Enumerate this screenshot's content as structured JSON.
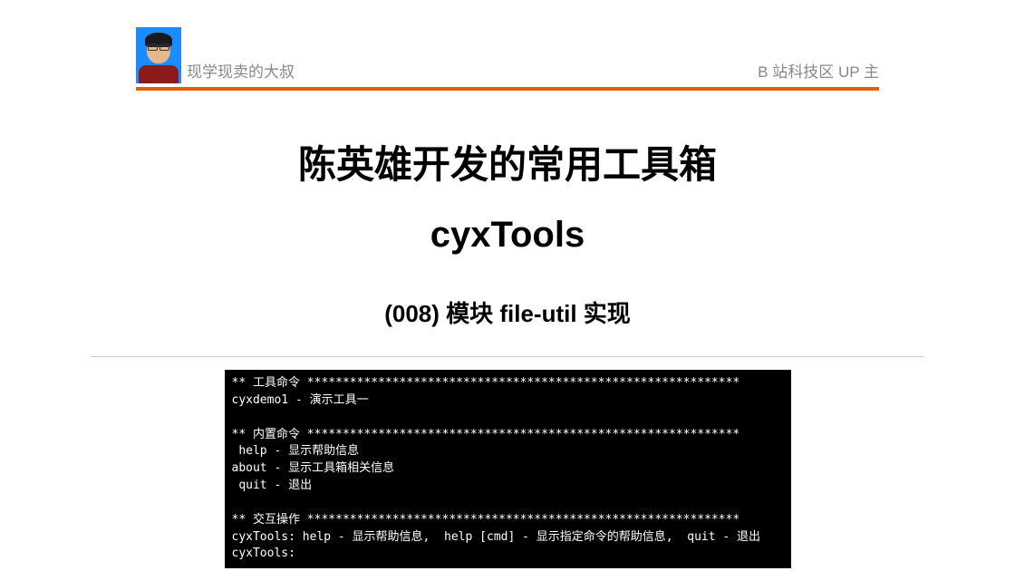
{
  "header": {
    "author_name": "现学现卖的大叔",
    "tagline": "B 站科技区 UP 主"
  },
  "main": {
    "title_cn": "陈英雄开发的常用工具箱",
    "title_en": "cyxTools",
    "subtitle": "(008)  模块 file-util  实现"
  },
  "terminal": {
    "section1_header": "** 工具命令 *************************************************************",
    "tool1": "cyxdemo1 - 演示工具一",
    "section2_header": "** 内置命令 *************************************************************",
    "builtin1": " help - 显示帮助信息",
    "builtin2": "about - 显示工具箱相关信息",
    "builtin3": " quit - 退出",
    "section3_header": "** 交互操作 *************************************************************",
    "interact1": "cyxTools: help - 显示帮助信息,  help [cmd] - 显示指定命令的帮助信息,  quit - 退出",
    "prompt": "cyxTools:"
  }
}
